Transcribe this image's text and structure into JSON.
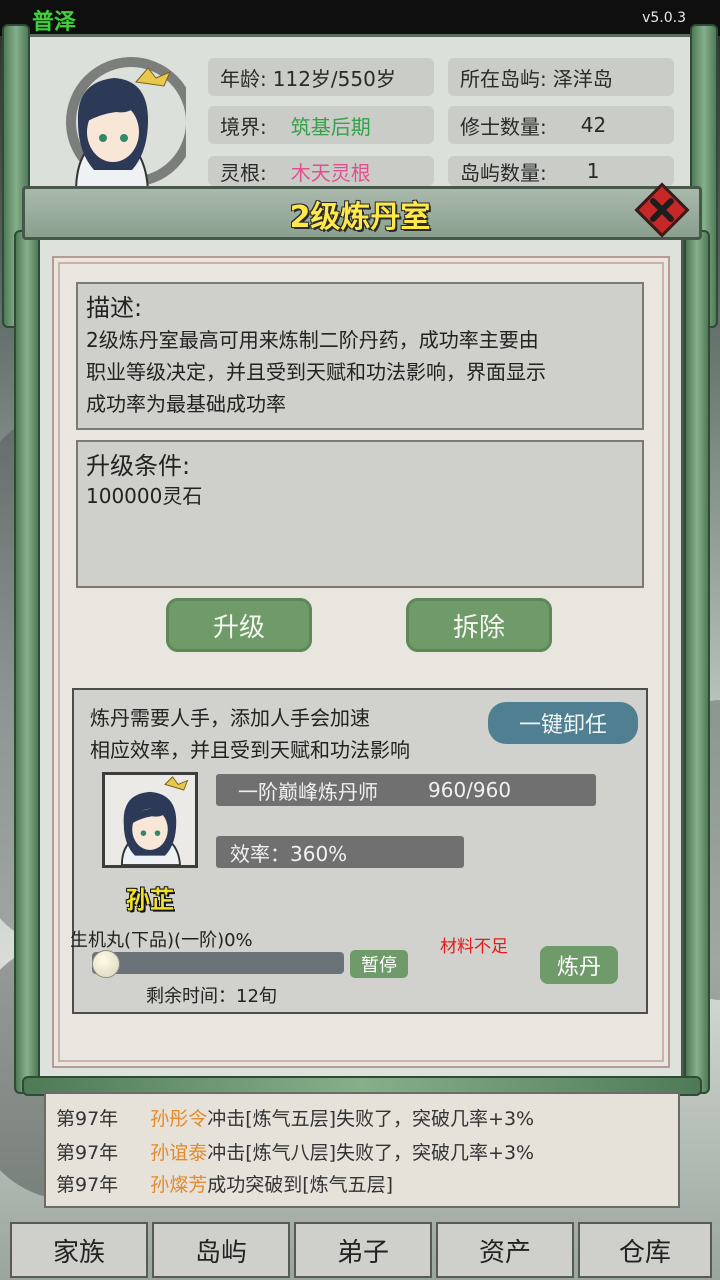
{
  "status_bar": {
    "season": "普泽",
    "version": "v5.0.3"
  },
  "header": {
    "age_label": "年龄:",
    "age_value": "112岁/550岁",
    "island_label": "所在岛屿:",
    "island_value": "泽洋岛",
    "realm_label": "境界:",
    "realm_value": "筑基后期",
    "cultivators_label": "修士数量:",
    "cultivators_value": "42",
    "root_label": "灵根:",
    "root_value": "木天灵根",
    "islands_label": "岛屿数量:",
    "islands_value": "1"
  },
  "dialog": {
    "title": "2级炼丹室",
    "description_title": "描述:",
    "description_lines": [
      "2级炼丹室最高可用来炼制二阶丹药，成功率主要由",
      "职业等级决定，并且受到天赋和功法影响，界面显示",
      "成功率为最基础成功率"
    ],
    "upgrade_title": "升级条件:",
    "upgrade_requirement": "100000灵石",
    "upgrade_button": "升级",
    "demolish_button": "拆除"
  },
  "workers": {
    "info_lines": [
      "炼丹需要人手，添加人手会加速",
      "相应效率，并且受到天赋和功法影响"
    ],
    "unassign_all": "一键卸任",
    "profession": "一阶巅峰炼丹师",
    "experience": "960/960",
    "efficiency": "效率：360%",
    "worker_name": "孙芷"
  },
  "production": {
    "item": "生机丸(下品)(一阶)0%",
    "progress_fraction": 0.0,
    "pause_button": "暂停",
    "warning": "材料不足",
    "alchemy_button": "炼丹",
    "remaining": "剩余时间：12旬"
  },
  "log": [
    {
      "year": "第97年",
      "name": "孙彤令",
      "text": "冲击[炼气五层]失败了，突破几率+3%"
    },
    {
      "year": "第97年",
      "name": "孙谊泰",
      "text": "冲击[炼气八层]失败了，突破几率+3%"
    },
    {
      "year": "第97年",
      "name": "孙燦芳",
      "text": "成功突破到[炼气五层]"
    }
  ],
  "tabs": [
    "家族",
    "岛屿",
    "弟子",
    "资产",
    "仓库"
  ],
  "colors": {
    "accent_green": "#6f9a69",
    "title_yellow": "#ffe84a",
    "warning_red": "#e31b1b",
    "name_orange": "#e48a2a",
    "realm_green": "#35a14a",
    "root_pink": "#e0508e"
  }
}
